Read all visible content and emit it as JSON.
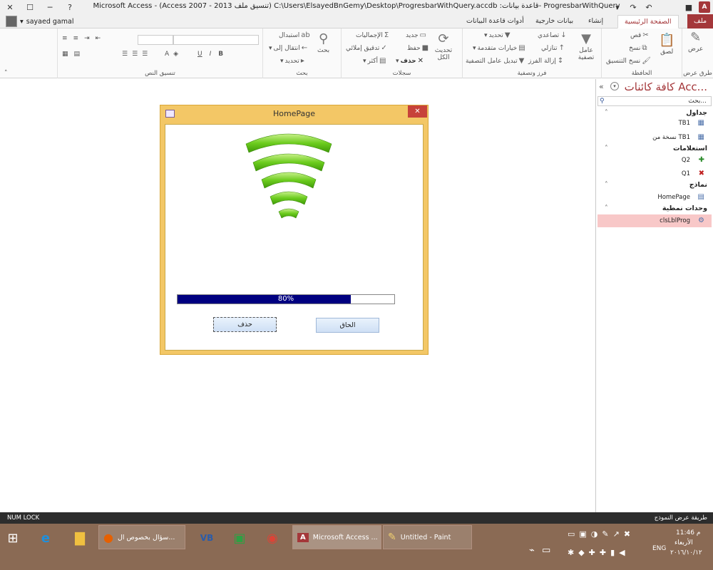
{
  "window": {
    "title": "Microsoft Access - (Access 2007 - 2013 تنسيق ملف) C:\\Users\\ElsayedBnGemy\\Desktop\\ProgresbarWithQuery.accdb :قاعدة بيانات- ProgresbarWithQuery",
    "app_icon_label": "A",
    "controls": {
      "help": "?",
      "minimize": "─",
      "maximize": "☐",
      "close": "✕"
    }
  },
  "user": {
    "name": "sayaed gamal"
  },
  "tabs": [
    {
      "label": "ملف",
      "state": "file"
    },
    {
      "label": "الصفحة الرئيسية",
      "state": "active"
    },
    {
      "label": "إنشاء"
    },
    {
      "label": "بيانات خارجية"
    },
    {
      "label": "أدوات قاعدة البيانات"
    }
  ],
  "ribbon": {
    "views": {
      "label": "طرق عرض",
      "view": "عرض"
    },
    "clipboard": {
      "label": "الحافظة",
      "paste": "لصق",
      "cut": "قص",
      "copy": "نسخ",
      "format_painter": "نسخ التنسيق"
    },
    "sort_filter": {
      "label": "فرز وتصفية",
      "filter": "عامل تصفية",
      "ascending": "تصاعدي",
      "descending": "تنازلي",
      "remove_sort": "إزالة الفرز",
      "selection": "تحديد",
      "advanced": "خيارات متقدمة",
      "toggle_filter": "تبديل عامل التصفية"
    },
    "records": {
      "label": "سجلات",
      "refresh": "تحديث الكل",
      "new": "جديد",
      "save": "حفظ",
      "delete": "حذف",
      "totals": "الإجماليات",
      "spelling": "تدقيق إملائي",
      "more": "أكثر"
    },
    "find": {
      "label": "بحث",
      "find": "بحث",
      "replace": "استبدال",
      "goto": "انتقال إلى",
      "select": "تحديد"
    },
    "text_format": {
      "label": "تنسيق النص",
      "bold": "B",
      "italic": "I",
      "underline": "U"
    }
  },
  "nav_pane": {
    "title": "كافة كائنات Acc...",
    "search_placeholder": "بحث...",
    "categories": [
      {
        "label": "جداول",
        "items": [
          {
            "label": "TB1",
            "icon": "table-icon"
          },
          {
            "label": "نسخة من TB1",
            "icon": "table-icon"
          }
        ]
      },
      {
        "label": "استعلامات",
        "items": [
          {
            "label": "Q2",
            "icon": "append-query-icon"
          },
          {
            "label": "Q1",
            "icon": "delete-query-icon"
          }
        ]
      },
      {
        "label": "نماذج",
        "items": [
          {
            "label": "HomePage",
            "icon": "form-icon"
          }
        ]
      },
      {
        "label": "وحدات نمطية",
        "items": [
          {
            "label": "clsLblProg",
            "icon": "class-module-icon",
            "selected": true
          }
        ]
      }
    ]
  },
  "dialog": {
    "title": "HomePage",
    "progress": {
      "value": 80,
      "text": "80%"
    },
    "buttons": {
      "delete": "حذف",
      "append": "الحاق"
    }
  },
  "status_bar": {
    "left": "NUM LOCK",
    "right": "طريقة عرض النموذج"
  },
  "taskbar": {
    "windows": [
      {
        "label": "سؤال بخصوص ال..."
      },
      {
        "label": "Microsoft Access ..."
      },
      {
        "label": "Untitled - Paint"
      }
    ],
    "tray": {
      "lang": "ENG",
      "time": "11:46 م",
      "day": "الأربعاء",
      "date": "٢٠١٦/١٠/١٢"
    }
  },
  "colors": {
    "accent": "#a4373a",
    "dialog_frame": "#f3c766",
    "progress_fill": "#000080",
    "signal_green": "#5cc41a"
  }
}
